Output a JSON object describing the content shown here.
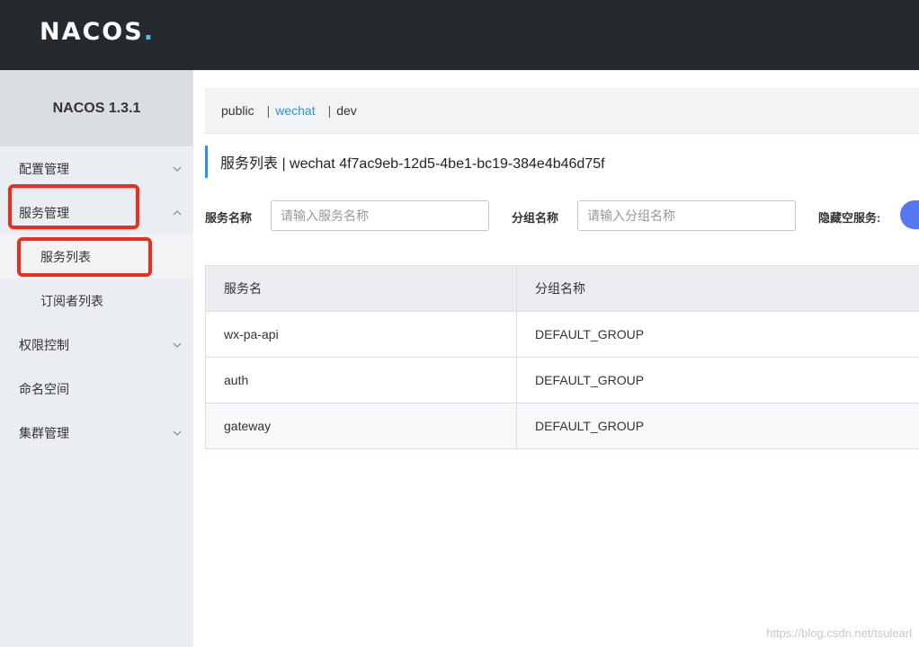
{
  "header": {
    "logo_text": "NACOS",
    "logo_dot": "."
  },
  "sidebar": {
    "version": "NACOS 1.3.1",
    "items": [
      {
        "label": "配置管理",
        "icon": "chevron-down-icon"
      },
      {
        "label": "服务管理",
        "icon": "chevron-up-icon"
      },
      {
        "label": "服务列表"
      },
      {
        "label": "订阅者列表"
      },
      {
        "label": "权限控制",
        "icon": "chevron-down-icon"
      },
      {
        "label": "命名空间"
      },
      {
        "label": "集群管理",
        "icon": "chevron-down-icon"
      }
    ]
  },
  "namespaces": {
    "items": [
      "public",
      "wechat",
      "dev"
    ],
    "selected": "wechat",
    "separator": "|"
  },
  "page": {
    "title": "服务列表  |  wechat  4f7ac9eb-12d5-4be1-bc19-384e4b46d75f"
  },
  "filters": {
    "service_label": "服务名称",
    "service_placeholder": "请输入服务名称",
    "group_label": "分组名称",
    "group_placeholder": "请输入分组名称",
    "hide_empty_label": "隐藏空服务:"
  },
  "table": {
    "headers": [
      "服务名",
      "分组名称"
    ],
    "rows": [
      [
        "wx-pa-api",
        "DEFAULT_GROUP"
      ],
      [
        "auth",
        "DEFAULT_GROUP"
      ],
      [
        "gateway",
        "DEFAULT_GROUP"
      ]
    ]
  },
  "watermark": "https://blog.csdn.net/tsulearl",
  "colors": {
    "topbar": "#252a2f",
    "accent": "#2a94e0",
    "highlight": "#ee2c1f",
    "toggle": "#5578f0"
  }
}
